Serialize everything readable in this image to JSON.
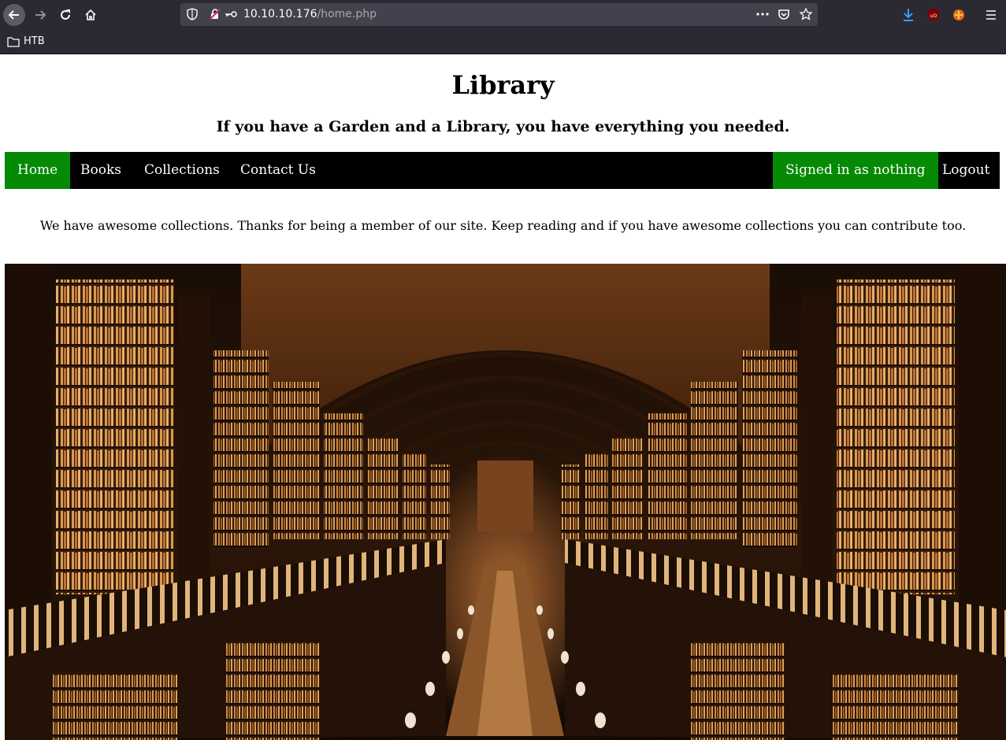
{
  "browser": {
    "url_host": "10.10.10.176",
    "url_path": "/home.php",
    "bookmarks": [
      {
        "label": "HTB",
        "icon": "folder-icon"
      }
    ],
    "icons": [
      "back-icon",
      "forward-icon",
      "reload-icon",
      "home-icon",
      "shield-icon",
      "insecure-lock-icon",
      "key-icon",
      "page-actions-icon",
      "pocket-icon",
      "bookmark-star-icon",
      "downloads-icon",
      "ublock-icon",
      "extension-icon",
      "menu-icon"
    ]
  },
  "site": {
    "title": "Library",
    "tagline": "If you have a Garden and a Library, you have everything you needed.",
    "nav": {
      "items": [
        {
          "label": "Home"
        },
        {
          "label": "Books"
        },
        {
          "label": "Collections"
        },
        {
          "label": "Contact Us"
        }
      ],
      "signed_in": "Signed in as nothing",
      "logout": "Logout"
    },
    "welcome_text": "We have awesome collections. Thanks for being a member of our site. Keep reading and if you have awesome collections you can contribute too."
  },
  "colors": {
    "active_nav": "#048a04",
    "nav_bg": "#000000",
    "chrome_bg": "#2b2a33",
    "urlbar_bg": "#42414d"
  }
}
